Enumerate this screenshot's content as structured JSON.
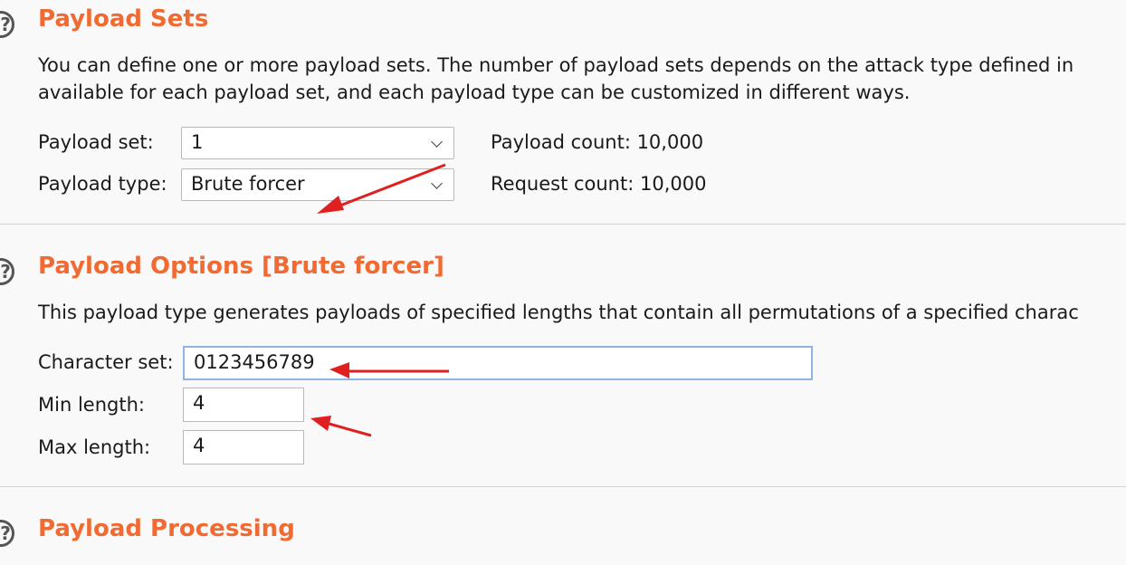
{
  "payload_sets": {
    "title": "Payload Sets",
    "description_line1": "You can define one or more payload sets. The number of payload sets depends on the attack type defined in",
    "description_line2": "available for each payload set, and each payload type can be customized in different ways.",
    "payload_set_label": "Payload set:",
    "payload_set_value": "1",
    "payload_type_label": "Payload type:",
    "payload_type_value": "Brute forcer",
    "payload_count": "Payload count: 10,000",
    "request_count": "Request count: 10,000"
  },
  "payload_options": {
    "title": "Payload Options [Brute forcer]",
    "description": "This payload type generates payloads of specified lengths that contain all permutations of a specified charac",
    "character_set_label": "Character set:",
    "character_set_value": "0123456789",
    "min_length_label": "Min length:",
    "min_length_value": "4",
    "max_length_label": "Max length:",
    "max_length_value": "4"
  },
  "payload_processing": {
    "title": "Payload Processing"
  },
  "colors": {
    "section_title": "#f06a32",
    "annotation_arrow": "#e02020",
    "focus_border": "#8fb4e3"
  },
  "icons": [
    "help-icon",
    "chevron-down-icon",
    "annotation-arrow"
  ]
}
